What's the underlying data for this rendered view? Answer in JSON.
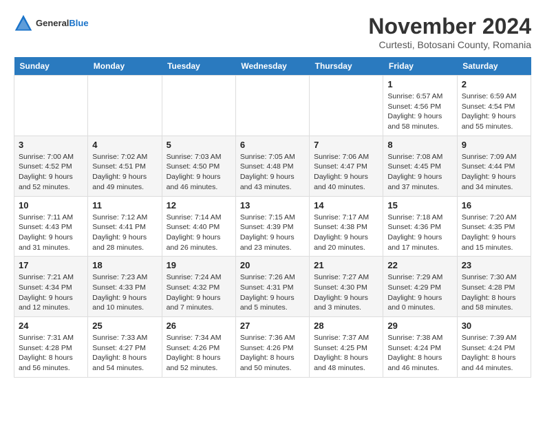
{
  "header": {
    "logo_general": "General",
    "logo_blue": "Blue",
    "month_title": "November 2024",
    "location": "Curtesti, Botosani County, Romania"
  },
  "weekdays": [
    "Sunday",
    "Monday",
    "Tuesday",
    "Wednesday",
    "Thursday",
    "Friday",
    "Saturday"
  ],
  "weeks": [
    {
      "days": [
        {
          "date": "",
          "info": ""
        },
        {
          "date": "",
          "info": ""
        },
        {
          "date": "",
          "info": ""
        },
        {
          "date": "",
          "info": ""
        },
        {
          "date": "",
          "info": ""
        },
        {
          "date": "1",
          "info": "Sunrise: 6:57 AM\nSunset: 4:56 PM\nDaylight: 9 hours and 58 minutes."
        },
        {
          "date": "2",
          "info": "Sunrise: 6:59 AM\nSunset: 4:54 PM\nDaylight: 9 hours and 55 minutes."
        }
      ]
    },
    {
      "days": [
        {
          "date": "3",
          "info": "Sunrise: 7:00 AM\nSunset: 4:52 PM\nDaylight: 9 hours and 52 minutes."
        },
        {
          "date": "4",
          "info": "Sunrise: 7:02 AM\nSunset: 4:51 PM\nDaylight: 9 hours and 49 minutes."
        },
        {
          "date": "5",
          "info": "Sunrise: 7:03 AM\nSunset: 4:50 PM\nDaylight: 9 hours and 46 minutes."
        },
        {
          "date": "6",
          "info": "Sunrise: 7:05 AM\nSunset: 4:48 PM\nDaylight: 9 hours and 43 minutes."
        },
        {
          "date": "7",
          "info": "Sunrise: 7:06 AM\nSunset: 4:47 PM\nDaylight: 9 hours and 40 minutes."
        },
        {
          "date": "8",
          "info": "Sunrise: 7:08 AM\nSunset: 4:45 PM\nDaylight: 9 hours and 37 minutes."
        },
        {
          "date": "9",
          "info": "Sunrise: 7:09 AM\nSunset: 4:44 PM\nDaylight: 9 hours and 34 minutes."
        }
      ]
    },
    {
      "days": [
        {
          "date": "10",
          "info": "Sunrise: 7:11 AM\nSunset: 4:43 PM\nDaylight: 9 hours and 31 minutes."
        },
        {
          "date": "11",
          "info": "Sunrise: 7:12 AM\nSunset: 4:41 PM\nDaylight: 9 hours and 28 minutes."
        },
        {
          "date": "12",
          "info": "Sunrise: 7:14 AM\nSunset: 4:40 PM\nDaylight: 9 hours and 26 minutes."
        },
        {
          "date": "13",
          "info": "Sunrise: 7:15 AM\nSunset: 4:39 PM\nDaylight: 9 hours and 23 minutes."
        },
        {
          "date": "14",
          "info": "Sunrise: 7:17 AM\nSunset: 4:38 PM\nDaylight: 9 hours and 20 minutes."
        },
        {
          "date": "15",
          "info": "Sunrise: 7:18 AM\nSunset: 4:36 PM\nDaylight: 9 hours and 17 minutes."
        },
        {
          "date": "16",
          "info": "Sunrise: 7:20 AM\nSunset: 4:35 PM\nDaylight: 9 hours and 15 minutes."
        }
      ]
    },
    {
      "days": [
        {
          "date": "17",
          "info": "Sunrise: 7:21 AM\nSunset: 4:34 PM\nDaylight: 9 hours and 12 minutes."
        },
        {
          "date": "18",
          "info": "Sunrise: 7:23 AM\nSunset: 4:33 PM\nDaylight: 9 hours and 10 minutes."
        },
        {
          "date": "19",
          "info": "Sunrise: 7:24 AM\nSunset: 4:32 PM\nDaylight: 9 hours and 7 minutes."
        },
        {
          "date": "20",
          "info": "Sunrise: 7:26 AM\nSunset: 4:31 PM\nDaylight: 9 hours and 5 minutes."
        },
        {
          "date": "21",
          "info": "Sunrise: 7:27 AM\nSunset: 4:30 PM\nDaylight: 9 hours and 3 minutes."
        },
        {
          "date": "22",
          "info": "Sunrise: 7:29 AM\nSunset: 4:29 PM\nDaylight: 9 hours and 0 minutes."
        },
        {
          "date": "23",
          "info": "Sunrise: 7:30 AM\nSunset: 4:28 PM\nDaylight: 8 hours and 58 minutes."
        }
      ]
    },
    {
      "days": [
        {
          "date": "24",
          "info": "Sunrise: 7:31 AM\nSunset: 4:28 PM\nDaylight: 8 hours and 56 minutes."
        },
        {
          "date": "25",
          "info": "Sunrise: 7:33 AM\nSunset: 4:27 PM\nDaylight: 8 hours and 54 minutes."
        },
        {
          "date": "26",
          "info": "Sunrise: 7:34 AM\nSunset: 4:26 PM\nDaylight: 8 hours and 52 minutes."
        },
        {
          "date": "27",
          "info": "Sunrise: 7:36 AM\nSunset: 4:26 PM\nDaylight: 8 hours and 50 minutes."
        },
        {
          "date": "28",
          "info": "Sunrise: 7:37 AM\nSunset: 4:25 PM\nDaylight: 8 hours and 48 minutes."
        },
        {
          "date": "29",
          "info": "Sunrise: 7:38 AM\nSunset: 4:24 PM\nDaylight: 8 hours and 46 minutes."
        },
        {
          "date": "30",
          "info": "Sunrise: 7:39 AM\nSunset: 4:24 PM\nDaylight: 8 hours and 44 minutes."
        }
      ]
    }
  ]
}
